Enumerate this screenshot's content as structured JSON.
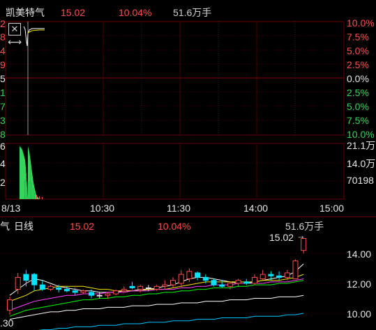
{
  "header": {
    "stock_name": "凯美特气",
    "price": "15.02",
    "change_pct": "10.04%",
    "volume": "51.6万手"
  },
  "intraday": {
    "left_axis": [
      "2",
      "8",
      "4",
      "9",
      "5",
      "1",
      "7",
      "3",
      "8"
    ],
    "right_axis": [
      "10.0%",
      "7.5%",
      "5.0%",
      "2.5%",
      "0.0%",
      "2.5%",
      "5.0%",
      "7.5%",
      "10.0%"
    ],
    "vol_left_axis": [
      "6",
      "4",
      "2"
    ],
    "vol_right_axis": [
      "21.1万",
      "14.0万",
      "70198"
    ],
    "time_labels": [
      "8/13",
      "10:30",
      "11:30",
      "14:00",
      "15:00"
    ],
    "close_icon": "close-icon",
    "expand_icon": "arrows-horizontal-icon"
  },
  "daily": {
    "title_prefix": "气",
    "title": "日线",
    "price": "15.02",
    "change_pct": "10.04%",
    "volume": "51.6万手",
    "last_price_marker": "15.02",
    "y_labels": [
      "14.00",
      "12.00",
      "10.00"
    ],
    "bottom_left_label": ".30"
  },
  "colors": {
    "up": "#ff4d4d",
    "down": "#00e5ff",
    "flat": "#e6e6e6",
    "grid": "#6b0000",
    "ma5": "#ffffff",
    "ma10": "#f5e600",
    "ma20": "#ff40ff",
    "ma30": "#00ff00",
    "ma60": "#ffffff",
    "ma120": "#00c8ff"
  },
  "candles": [
    {
      "o": 10.2,
      "h": 11.1,
      "l": 9.9,
      "c": 10.9
    },
    {
      "o": 11.6,
      "h": 12.7,
      "l": 11.3,
      "c": 12.4
    },
    {
      "o": 12.6,
      "h": 12.9,
      "l": 11.8,
      "c": 12.2
    },
    {
      "o": 12.6,
      "h": 12.7,
      "l": 11.5,
      "c": 11.9
    },
    {
      "o": 11.9,
      "h": 12.2,
      "l": 11.5,
      "c": 11.6
    },
    {
      "o": 11.6,
      "h": 11.9,
      "l": 11.5,
      "c": 11.8
    },
    {
      "o": 11.7,
      "h": 11.9,
      "l": 11.4,
      "c": 11.6
    },
    {
      "o": 11.6,
      "h": 11.8,
      "l": 11.4,
      "c": 11.5
    },
    {
      "o": 11.5,
      "h": 11.7,
      "l": 11.2,
      "c": 11.4
    },
    {
      "o": 11.4,
      "h": 11.6,
      "l": 11.3,
      "c": 11.5
    },
    {
      "o": 11.4,
      "h": 11.6,
      "l": 11.0,
      "c": 11.2
    },
    {
      "o": 11.2,
      "h": 11.4,
      "l": 11.0,
      "c": 11.2
    },
    {
      "o": 11.2,
      "h": 11.4,
      "l": 11.0,
      "c": 11.3
    },
    {
      "o": 11.3,
      "h": 11.6,
      "l": 11.2,
      "c": 11.5
    },
    {
      "o": 11.5,
      "h": 11.8,
      "l": 11.4,
      "c": 11.6
    },
    {
      "o": 11.8,
      "h": 12.1,
      "l": 11.6,
      "c": 11.7
    },
    {
      "o": 11.6,
      "h": 11.9,
      "l": 11.4,
      "c": 11.8
    },
    {
      "o": 11.7,
      "h": 11.9,
      "l": 11.5,
      "c": 11.7
    },
    {
      "o": 11.6,
      "h": 11.9,
      "l": 11.5,
      "c": 11.8
    },
    {
      "o": 11.8,
      "h": 12.2,
      "l": 11.6,
      "c": 11.9
    },
    {
      "o": 11.9,
      "h": 12.4,
      "l": 11.7,
      "c": 12.2
    },
    {
      "o": 12.0,
      "h": 12.9,
      "l": 11.8,
      "c": 12.6
    },
    {
      "o": 12.3,
      "h": 13.0,
      "l": 12.1,
      "c": 12.8
    },
    {
      "o": 12.7,
      "h": 12.8,
      "l": 12.2,
      "c": 12.4
    },
    {
      "o": 12.4,
      "h": 12.6,
      "l": 12.0,
      "c": 12.2
    },
    {
      "o": 12.2,
      "h": 12.3,
      "l": 11.8,
      "c": 11.9
    },
    {
      "o": 11.9,
      "h": 12.2,
      "l": 11.7,
      "c": 11.8
    },
    {
      "o": 11.8,
      "h": 12.1,
      "l": 11.6,
      "c": 12.0
    },
    {
      "o": 12.0,
      "h": 12.3,
      "l": 11.8,
      "c": 12.2
    },
    {
      "o": 12.1,
      "h": 12.3,
      "l": 11.9,
      "c": 12.0
    },
    {
      "o": 12.0,
      "h": 12.6,
      "l": 11.9,
      "c": 12.4
    },
    {
      "o": 12.3,
      "h": 12.9,
      "l": 12.2,
      "c": 12.6
    },
    {
      "o": 12.6,
      "h": 12.8,
      "l": 12.2,
      "c": 12.5
    },
    {
      "o": 12.5,
      "h": 12.8,
      "l": 12.2,
      "c": 12.4
    },
    {
      "o": 12.4,
      "h": 12.9,
      "l": 12.2,
      "c": 12.7
    },
    {
      "o": 12.3,
      "h": 13.6,
      "l": 12.3,
      "c": 13.5
    },
    {
      "o": 14.2,
      "h": 15.0,
      "l": 14.0,
      "c": 15.0
    }
  ],
  "ma_lines": {
    "ma5": [
      11.2,
      11.6,
      12.0,
      12.3,
      12.2,
      12.0,
      11.8,
      11.7,
      11.6,
      11.5,
      11.5,
      11.4,
      11.4,
      11.4,
      11.5,
      11.5,
      11.6,
      11.6,
      11.7,
      11.8,
      11.9,
      12.1,
      12.3,
      12.4,
      12.4,
      12.3,
      12.2,
      12.1,
      12.0,
      12.0,
      12.1,
      12.2,
      12.3,
      12.4,
      12.5,
      12.8,
      13.3
    ],
    "ma10": [
      10.8,
      11.0,
      11.2,
      11.5,
      11.6,
      11.7,
      11.8,
      11.8,
      11.8,
      11.8,
      11.7,
      11.6,
      11.6,
      11.5,
      11.5,
      11.5,
      11.5,
      11.6,
      11.6,
      11.6,
      11.7,
      11.8,
      11.9,
      12.0,
      12.1,
      12.1,
      12.1,
      12.1,
      12.1,
      12.1,
      12.1,
      12.2,
      12.2,
      12.2,
      12.3,
      12.4,
      12.6
    ],
    "ma20": [
      10.2,
      10.4,
      10.6,
      10.8,
      10.9,
      11.0,
      11.1,
      11.2,
      11.2,
      11.3,
      11.3,
      11.3,
      11.4,
      11.4,
      11.4,
      11.5,
      11.5,
      11.5,
      11.6,
      11.6,
      11.6,
      11.7,
      11.7,
      11.8,
      11.8,
      11.9,
      11.9,
      11.9,
      12.0,
      12.0,
      12.0,
      12.0,
      12.1,
      12.1,
      12.1,
      12.2,
      12.3
    ],
    "ma30": [
      9.8,
      10.0,
      10.2,
      10.3,
      10.4,
      10.5,
      10.6,
      10.7,
      10.8,
      10.9,
      10.9,
      11.0,
      11.0,
      11.1,
      11.1,
      11.2,
      11.2,
      11.3,
      11.3,
      11.4,
      11.4,
      11.5,
      11.5,
      11.6,
      11.6,
      11.7,
      11.7,
      11.7,
      11.8,
      11.8,
      11.9,
      11.9,
      11.9,
      12.0,
      12.0,
      12.1,
      12.2
    ],
    "ma60": [
      9.6,
      9.7,
      9.8,
      9.9,
      10.0,
      10.1,
      10.1,
      10.2,
      10.2,
      10.3,
      10.3,
      10.3,
      10.4,
      10.4,
      10.4,
      10.5,
      10.5,
      10.5,
      10.6,
      10.6,
      10.6,
      10.7,
      10.7,
      10.7,
      10.8,
      10.8,
      10.8,
      10.9,
      10.9,
      10.9,
      11.0,
      11.0,
      11.0,
      11.1,
      11.1,
      11.1,
      11.2
    ],
    "ma120": [
      8.6,
      8.7,
      8.8,
      8.8,
      8.9,
      8.9,
      9.0,
      9.0,
      9.1,
      9.1,
      9.1,
      9.2,
      9.2,
      9.2,
      9.3,
      9.3,
      9.3,
      9.4,
      9.4,
      9.4,
      9.5,
      9.5,
      9.5,
      9.6,
      9.6,
      9.6,
      9.7,
      9.7,
      9.7,
      9.7,
      9.8,
      9.8,
      9.8,
      9.8,
      9.9,
      9.9,
      10.0
    ]
  }
}
